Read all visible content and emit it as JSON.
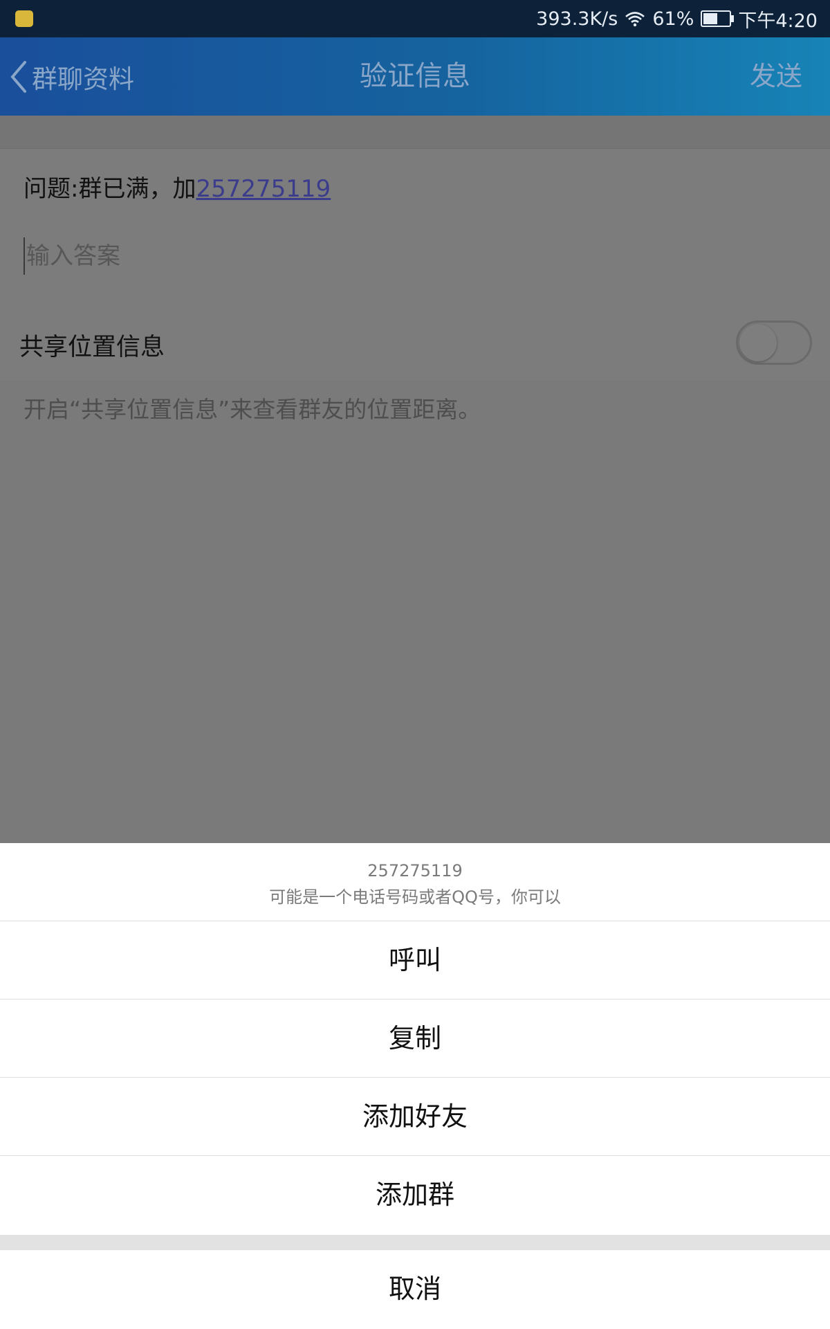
{
  "status_bar": {
    "speed": "393.3K/s",
    "battery": "61%",
    "battery_level": 0.61,
    "time": "下午4:20",
    "icons": [
      "app-notification-icon",
      "wifi-icon",
      "battery-icon"
    ]
  },
  "nav": {
    "back_label": "群聊资料",
    "title": "验证信息",
    "send_label": "发送"
  },
  "question": {
    "prefix": "问题:群已满，加",
    "number": "257275119"
  },
  "answer": {
    "value": "",
    "placeholder": "输入答案"
  },
  "share": {
    "label": "共享位置信息",
    "enabled": false,
    "hint": "开启“共享位置信息”来查看群友的位置距离。"
  },
  "sheet": {
    "number": "257275119",
    "description": "可能是一个电话号码或者QQ号，你可以",
    "options": [
      "呼叫",
      "复制",
      "添加好友",
      "添加群"
    ],
    "cancel": "取消"
  },
  "colors": {
    "nav_start": "#1a4f9b",
    "nav_end": "#1783b6",
    "link": "#3c3c8c",
    "overlay": "#7a7a7a"
  }
}
